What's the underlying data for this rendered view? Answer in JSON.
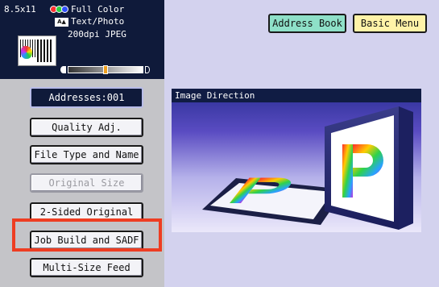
{
  "status": {
    "paper_size": "8.5x11",
    "color_mode": "Full Color",
    "mode_icon": "text-photo-icon",
    "original_type": "Text/Photo",
    "resolution_format": "200dpi JPEG",
    "density_level": 0.5
  },
  "top_buttons": {
    "address_book": "Address Book",
    "basic_menu": "Basic Menu"
  },
  "left_menu": {
    "addresses": "Addresses:001",
    "items": [
      {
        "label": "Quality Adj.",
        "enabled": true
      },
      {
        "label": "File Type and Name",
        "enabled": true
      },
      {
        "label": "Original Size",
        "enabled": false
      },
      {
        "label": "2-Sided Original",
        "enabled": true
      },
      {
        "label": "Job Build and SADF",
        "enabled": true,
        "highlighted": true
      },
      {
        "label": "Multi-Size Feed",
        "enabled": true
      }
    ]
  },
  "main": {
    "panel_title": "Image Direction",
    "illustration_letter": "P"
  },
  "colors": {
    "status_bg": "#0f1a3a",
    "screen_bg": "#d3d2ee",
    "left_bg": "#c4c4c8",
    "address_book_bg": "#8ee0c8",
    "basic_menu_bg": "#fff3a8",
    "highlight": "#ee3d22"
  }
}
